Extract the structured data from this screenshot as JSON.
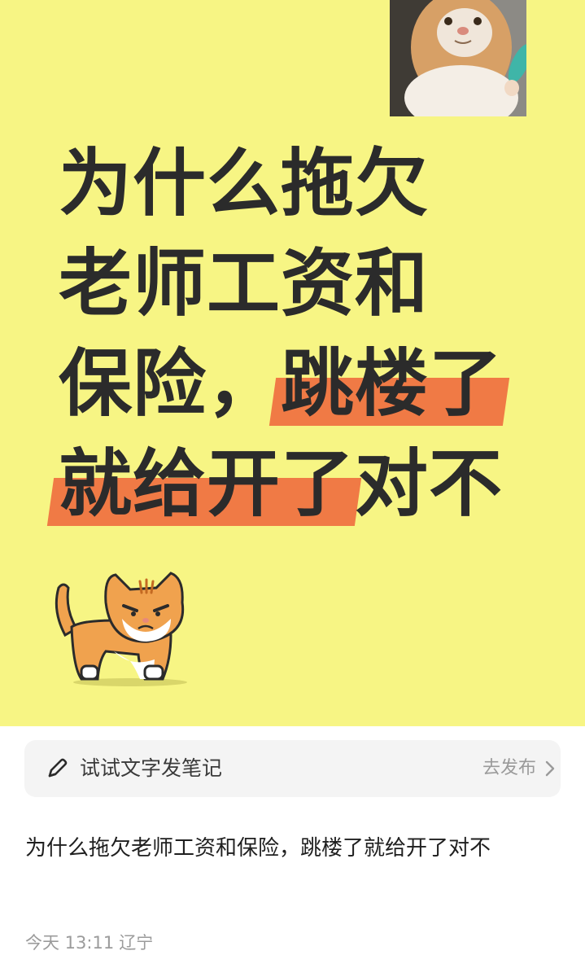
{
  "poster": {
    "background_color": "#f7f584",
    "highlight_color": "#f07a45",
    "headline": {
      "line1": "为什么拖欠",
      "line2": "老师工资和",
      "line3_plain": "保险，",
      "line3_marked": "跳楼了",
      "line4_marked": "就给开了",
      "line4_plain": "对不"
    },
    "top_image_icon": "cat-meme-photo",
    "bottom_image_icon": "grumpy-orange-cat-cartoon"
  },
  "composer": {
    "placeholder": "试试文字发笔记",
    "publish_label": "去发布",
    "icon": "pencil-icon"
  },
  "post": {
    "body": "为什么拖欠老师工资和保险，跳楼了就给开了对不",
    "date": "今天 13:11",
    "location": "辽宁"
  }
}
